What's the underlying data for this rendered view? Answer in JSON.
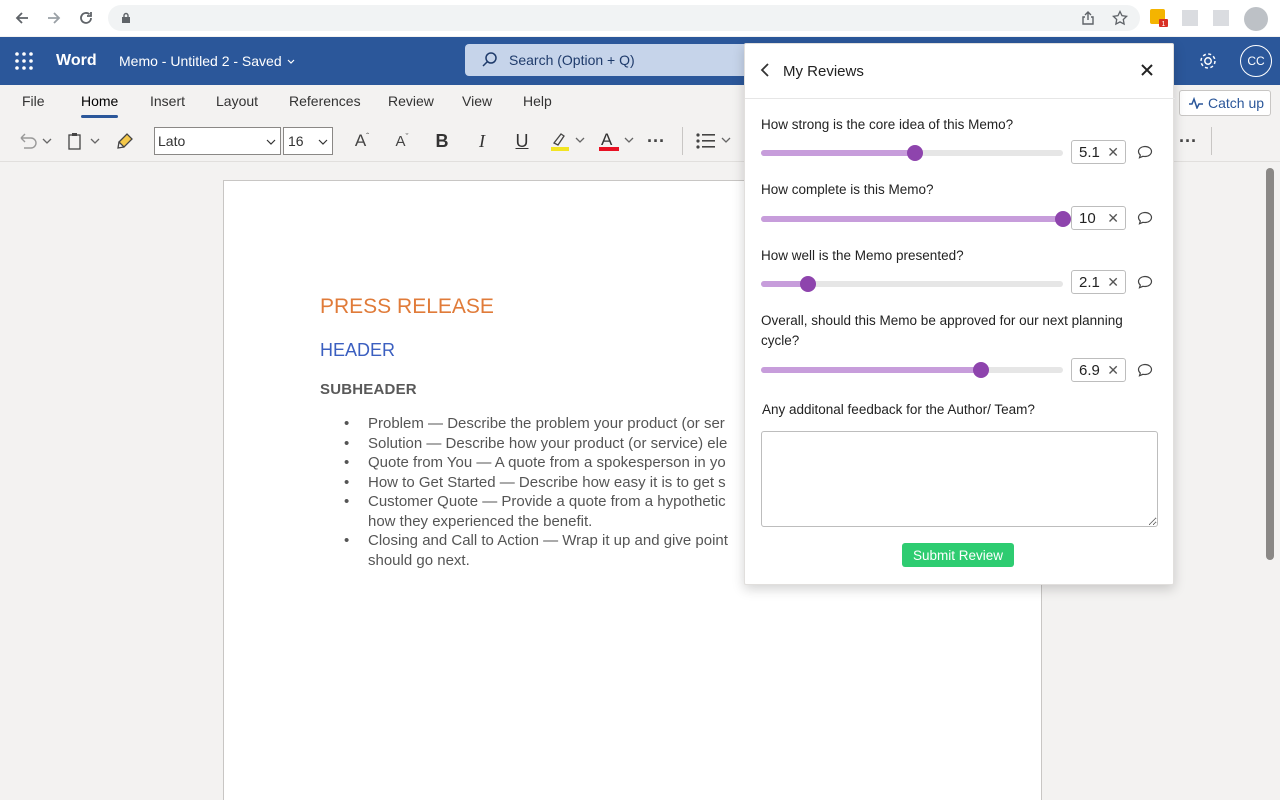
{
  "browser": {
    "icons": [
      "back-arrow-icon",
      "forward-arrow-icon",
      "reload-icon",
      "lock-icon",
      "share-icon",
      "star-icon",
      "extension-icon",
      "profile-icon"
    ],
    "extension_badge": "1"
  },
  "titlebar": {
    "app_name": "Word",
    "doc_title": "Memo - Untitled 2  -  Saved",
    "search_placeholder": "Search (Option + Q)",
    "avatar_initials": "CC"
  },
  "ribbon": {
    "tabs": [
      "File",
      "Home",
      "Insert",
      "Layout",
      "References",
      "Review",
      "View",
      "Help"
    ],
    "active_tab": "Home",
    "catch_up": "Catch up",
    "font_name": "Lato",
    "font_size": "16"
  },
  "document": {
    "title": "PRESS RELEASE",
    "header": "HEADER",
    "subheader": "SUBHEADER",
    "bullets": [
      "Problem — Describe the problem your product (or ser",
      "Solution — Describe how your product (or service) ele",
      "Quote from You — A quote from a spokesperson in yo",
      "How to Get Started — Describe how easy it is to get s",
      "Customer Quote — Provide a quote from a hypothetic\nhow they experienced the benefit.",
      "Closing and Call to Action — Wrap it up and give point\nshould go next."
    ]
  },
  "review_panel": {
    "title": "My Reviews",
    "questions": [
      {
        "label": "How strong is the core idea of this Memo?",
        "value": "5.1",
        "fraction": 0.51
      },
      {
        "label": "How complete is this Memo?",
        "value": "10",
        "fraction": 1.0
      },
      {
        "label": "How well is the Memo presented?",
        "value": "2.1",
        "fraction": 0.155
      },
      {
        "label": "Overall, should this Memo be approved for our next planning cycle?",
        "value": "6.9",
        "fraction": 0.73
      }
    ],
    "feedback_label": "Any additonal feedback for the Author/ Team?",
    "feedback_value": "",
    "submit_label": "Submit Review"
  },
  "colors": {
    "word_blue": "#2b579a",
    "slider_fill": "#c79ddb",
    "slider_thumb": "#8e44ad",
    "submit_green": "#2ecc71",
    "press_orange": "#e07b39",
    "header_blue": "#3b5fc0"
  }
}
